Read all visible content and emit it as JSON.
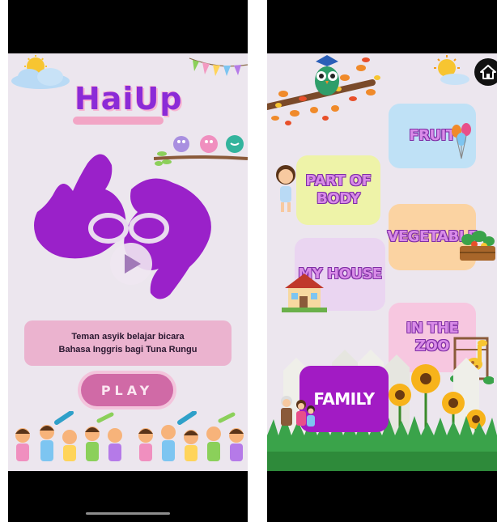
{
  "left_screen": {
    "logo": "HaiUp",
    "tagline_line1": "Teman asyik belajar bicara",
    "tagline_line2": "Bahasa Inggris bagi Tuna Rungu",
    "play_label": "PLAY",
    "icons": [
      "sun-icon",
      "cloud-icon",
      "bunting-icon",
      "birds-icon",
      "sign-language-hands-icon",
      "play-icon",
      "children-illustration"
    ]
  },
  "right_screen": {
    "categories": [
      {
        "label": "FRUIT"
      },
      {
        "label_line1": "PART OF",
        "label_line2": "BODY"
      },
      {
        "label": "VEGETABLE"
      },
      {
        "label": "MY HOUSE"
      },
      {
        "label": "IN THE ZOO"
      },
      {
        "label": "FAMILY"
      }
    ],
    "icons": [
      "owl-icon",
      "branch-icon",
      "sun-icon",
      "home-icon",
      "girl-icon",
      "house-icon",
      "vegetable-basket-icon",
      "balloons-icon",
      "giraffe-icon",
      "family-icon",
      "sunflower-garden-illustration"
    ]
  },
  "colors": {
    "logo_purple": "#8b2bd7",
    "hands_purple": "#9a21c9",
    "play_pink": "#d06aa6",
    "family_purple": "#a21bc4",
    "background": "#ece6ee"
  }
}
